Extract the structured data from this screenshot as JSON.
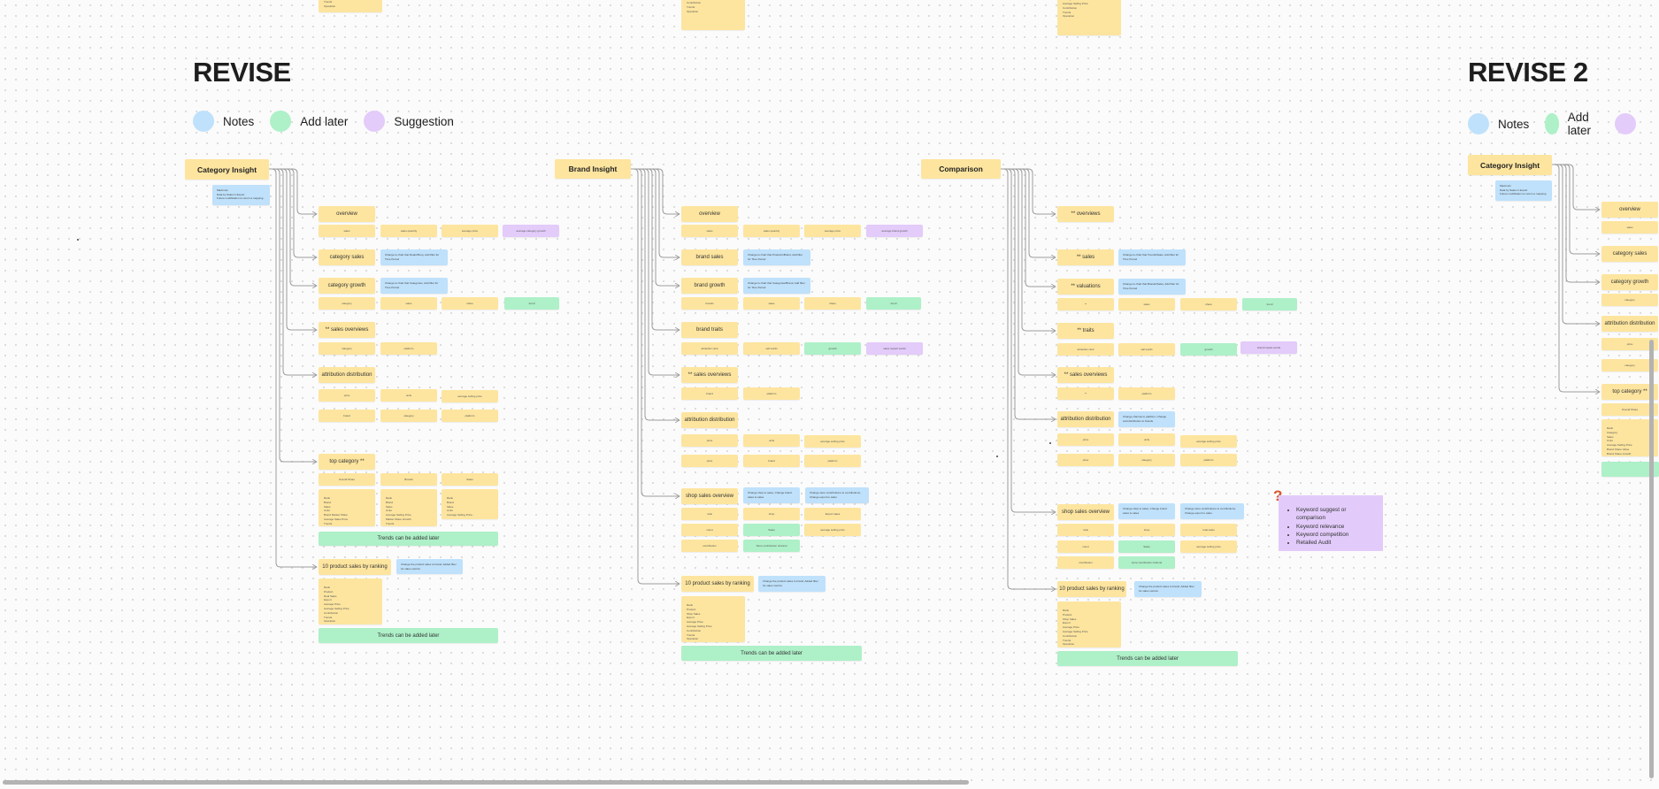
{
  "boards": [
    {
      "title": "REVISE",
      "legend": [
        {
          "label": "Notes",
          "color": "#bfe1fb"
        },
        {
          "label": "Add later",
          "color": "#aef0c8"
        },
        {
          "label": "Suggestion",
          "color": "#e3cbfa"
        }
      ]
    },
    {
      "title": "REVISE 2",
      "legend": [
        {
          "label": "Notes",
          "color": "#bfe1fb"
        },
        {
          "label": "Add later",
          "color": "#aef0c8"
        }
      ]
    }
  ],
  "top_partial": {
    "a": "Trends\nOperation",
    "b": "Shop Sales\nExport\nAverage Price\nAverage Selling Price\nContribution\nTrends\nOperation",
    "c": "Shop Info\nProduct\nDeal Sales\nExport\nAverage Price\nAverage Selling Price\nContribution\nTrends\nOperation"
  },
  "category_insight": {
    "root": "Category Insight",
    "root_note": "Maximum\nData by Sales in Export\nFuture modification to return a mapping",
    "overview": {
      "label": "overview",
      "items": [
        "sales",
        "sales quantity",
        "average price"
      ],
      "suggestion": "average category growth"
    },
    "category_sales": {
      "label": "category sales",
      "note": "Change to chart that Deals/Shop, Add filter for Time Period"
    },
    "category_growth": {
      "label": "category growth",
      "note": "Change to chart that Categories, Add filter for Time Period",
      "items": [
        "category",
        "sales",
        "share"
      ],
      "later": "trend"
    },
    "sales_overviews": {
      "label": "** sales overviews",
      "items": [
        "category",
        "platform"
      ]
    },
    "attribution": {
      "label": "attribution distribution",
      "row1": [
        "price",
        "units",
        "average selling price"
      ],
      "row2": [
        "brand",
        "category",
        "platform"
      ]
    },
    "top_category": {
      "label": "top category **",
      "cols": [
        "Overall Share",
        "Brands",
        "Sales"
      ],
      "lists": [
        "Rank\nBrand\nSales\nUnits\nBrand Market Share\nAverage Sales Price\nTrends",
        "Rank\nBrand\nSales\nUnits\nAverage Selling Price\nMarket Share Growth\nTrends",
        "Rank\nBrand\nValue\nUnits\nAverage Selling Price..."
      ],
      "trends": "Trends can be added later"
    },
    "ranking": {
      "label": "10 product sales by ranking",
      "note": "Change the product sales to brand, Added filter for sales metrics",
      "list": "Rank\nProduct\nDeal Sales\nExport\nAverage Price\nAverage Selling Price\nContribution\nTrends\nOperation",
      "trends": "Trends can be added later"
    }
  },
  "brand_insight": {
    "root": "Brand Insight",
    "overview": {
      "label": "overview",
      "items": [
        "sales",
        "sales quantity",
        "average price"
      ],
      "suggestion": "average brand growth"
    },
    "brand_sales": {
      "label": "brand sales",
      "note": "Change to chart that Products/Brand, Add filter for Time Period"
    },
    "brand_growth": {
      "label": "brand growth",
      "note": "Change to chart that Categories/Brand, Add filter for Time Period",
      "items": [
        "brands",
        "sales",
        "share"
      ],
      "later": "trend"
    },
    "brand_traits": {
      "label": "brand traits",
      "items": [
        "attraction rank",
        "sell words"
      ],
      "later": "growth",
      "suggestion": "sales impact words"
    },
    "sales_overviews": {
      "label": "** sales overviews",
      "items": [
        "brand",
        "platform"
      ]
    },
    "attribution": {
      "label": "attribution distribution",
      "row1": [
        "price",
        "units",
        "average selling price"
      ],
      "row2": [
        "price",
        "brand",
        "platform"
      ]
    },
    "shop_sales": {
      "label": "shop sales overview",
      "note1": "Change shop to sales, Change brand sales to sales",
      "note2": "Change store contributions to contributions, Change export to sales",
      "row1": [
        "rank",
        "shop",
        "Export sales"
      ],
      "row2": [
        "count",
        "Sales"
      ],
      "row2_tail": "average selling price",
      "row2_later": "Sales",
      "row3": [
        "contribution"
      ],
      "row3_later": "Store contribution channel"
    },
    "ranking": {
      "label": "10 product sales by ranking",
      "note": "Change the product sales to brand, Added filter for sales metrics",
      "list": "Rank\nProduct\nShop Sales\nExport\nAverage Price\nAverage Selling Price\nContribution\nTrends\nOperation",
      "trends": "Trends can be added later"
    }
  },
  "comparison": {
    "root": "Comparison",
    "overviews": {
      "label": "** overviews"
    },
    "sales": {
      "label": "** sales",
      "note": "Change to chart that Trends/Sales, Add filter for Time Period"
    },
    "valuations": {
      "label": "** valuations",
      "note": "Change to chart that Brands/Sales, Add filter for Time Period",
      "items": [
        "**",
        "sales",
        "share"
      ],
      "later": "trend"
    },
    "traits": {
      "label": "** traits",
      "items": [
        "attraction rank",
        "sell words"
      ],
      "later": "growth",
      "suggestion": "brand impact words"
    },
    "sales_overviews": {
      "label": "** sales overviews",
      "items": [
        "**",
        "platform"
      ]
    },
    "attribution": {
      "label": "attribution distribution",
      "note": "Change channel to platform, Change sold distribution to brands",
      "row1": [
        "price",
        "units",
        "average selling price"
      ],
      "row2": [
        "price",
        "category",
        "platform"
      ]
    },
    "shop_sales": {
      "label": "shop sales overview",
      "note1": "Change shop to sales, Change brand sales to sales",
      "note2": "Change store contributions to contributions, Change export to sales",
      "row1": [
        "rank",
        "shop",
        "total sales"
      ],
      "row2": [
        "count"
      ],
      "row2_later": "Sales",
      "row2_tail": "average selling price",
      "row3": [
        "contribution"
      ],
      "row3_later": "store contribution channel"
    },
    "ranking": {
      "label": "10 product sales by ranking",
      "note": "Change the product sales to brand, Added filter for sales metrics",
      "list": "Rank\nProduct\nShop Sales\nExport\nAverage Price\nAverage Selling Price\nContribution\nTrends\nOperation",
      "trends": "Trends can be added later"
    }
  },
  "suggestion_card": {
    "icon": "question-mark-icon",
    "items": [
      "Keyword suggest or comparison",
      "Keyword relevance",
      "Keyword competition",
      "Retailed Audit"
    ]
  },
  "revise2_category": {
    "root": "Category Insight",
    "root_note": "Maximum\nData by Sales in Export\nFuture modification to return a mapping",
    "overview": "overview",
    "overview_item": "sales",
    "category_sales": "category sales",
    "category_growth": "category growth",
    "growth_item": "category",
    "attribution": "attribution distribution",
    "attr_items": [
      "price",
      "category"
    ],
    "top_category": "top category **",
    "top_col": "Overall Share",
    "top_list": "Rank\nCategory\nSales\nUnits\nAverage Selling Price\nBrand Share Value\nBrand Share Growth"
  }
}
